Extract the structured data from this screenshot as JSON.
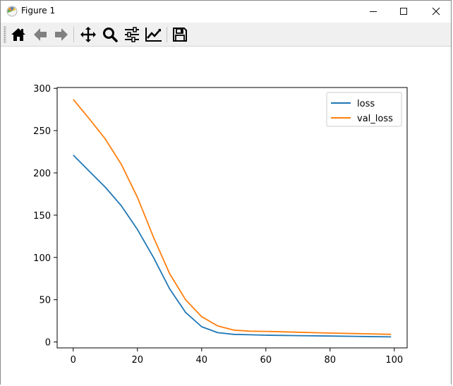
{
  "window": {
    "title": "Figure 1",
    "controls": [
      "minimize",
      "maximize",
      "close"
    ]
  },
  "toolbar": {
    "buttons": [
      {
        "name": "home",
        "icon": "home-icon"
      },
      {
        "name": "back",
        "icon": "arrow-left-icon"
      },
      {
        "name": "forward",
        "icon": "arrow-right-icon"
      },
      {
        "name": "pan",
        "icon": "move-icon"
      },
      {
        "name": "zoom",
        "icon": "magnifier-icon"
      },
      {
        "name": "configure-subplots",
        "icon": "sliders-icon"
      },
      {
        "name": "edit-axis",
        "icon": "line-chart-icon"
      },
      {
        "name": "save",
        "icon": "floppy-disk-icon"
      }
    ]
  },
  "chart_data": {
    "type": "line",
    "title": "",
    "xlabel": "",
    "ylabel": "",
    "xlim": [
      -5,
      104
    ],
    "ylim": [
      -7,
      301
    ],
    "xticks": [
      0,
      20,
      40,
      60,
      80,
      100
    ],
    "yticks": [
      0,
      50,
      100,
      150,
      200,
      250,
      300
    ],
    "grid": false,
    "legend": {
      "position": "top-right",
      "entries": [
        "loss",
        "val_loss"
      ]
    },
    "series": [
      {
        "name": "loss",
        "color": "#1f77b4",
        "x": [
          0,
          5,
          10,
          15,
          20,
          25,
          30,
          35,
          40,
          45,
          50,
          55,
          60,
          70,
          80,
          90,
          99
        ],
        "y": [
          221,
          202,
          183,
          161,
          133,
          100,
          63,
          35,
          18,
          11,
          9,
          8.5,
          8,
          7.5,
          7,
          6.5,
          6
        ]
      },
      {
        "name": "val_loss",
        "color": "#ff7f0e",
        "x": [
          0,
          5,
          10,
          15,
          20,
          25,
          30,
          35,
          40,
          45,
          50,
          55,
          60,
          70,
          80,
          90,
          99
        ],
        "y": [
          287,
          264,
          240,
          210,
          171,
          124,
          81,
          50,
          30,
          19,
          14,
          12.8,
          12.5,
          11.5,
          10.5,
          9.8,
          9
        ]
      }
    ]
  },
  "colors": {
    "loss": "#1f77b4",
    "val_loss": "#ff7f0e",
    "toolbar_bg": "#f0f0f0"
  }
}
